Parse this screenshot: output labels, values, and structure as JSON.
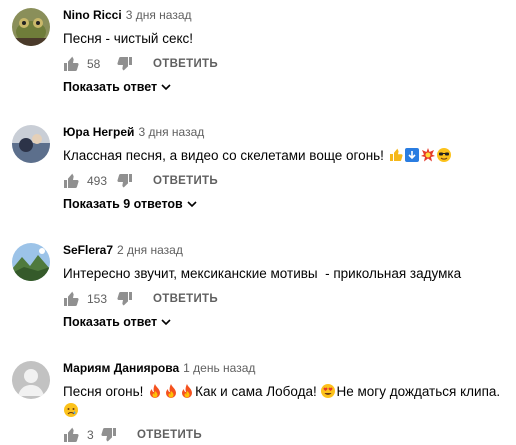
{
  "comments": [
    {
      "author": "Nino Ricci",
      "time": "3 дня назад",
      "text": "Песня - чистый секс!",
      "likes": "58",
      "reply_label": "ОТВЕТИТЬ",
      "replies_label": "Показать ответ",
      "avatar_icon": "frog-avatar"
    },
    {
      "author": "Юра Негрей",
      "time": "3 дня назад",
      "text": "Классная песня, а видео со скелетами воще огонь!",
      "emojis": [
        "thumbs-up",
        "blue-arrow-square",
        "collision",
        "sunglasses-face"
      ],
      "likes": "493",
      "reply_label": "ОТВЕТИТЬ",
      "replies_label": "Показать 9 ответов",
      "avatar_icon": "photo-avatar"
    },
    {
      "author": "SeFlera7",
      "time": "2 дня назад",
      "text": "Интересно звучит, мексиканские мотивы  - прикольная задумка",
      "likes": "153",
      "reply_label": "ОТВЕТИТЬ",
      "replies_label": "Показать ответ",
      "avatar_icon": "landscape-avatar"
    },
    {
      "author": "Мариям Даниярова",
      "time": "1 день назад",
      "text_part1": "Песня огонь!",
      "text_part2": "Как и сама Лобода!",
      "text_part3": "Не могу дождаться клипа.",
      "emojis": [
        "fire",
        "fire",
        "fire",
        "heart-eyes",
        "sad-face"
      ],
      "likes": "3",
      "reply_label": "ОТВЕТИТЬ",
      "avatar_icon": "default-user-avatar"
    }
  ]
}
